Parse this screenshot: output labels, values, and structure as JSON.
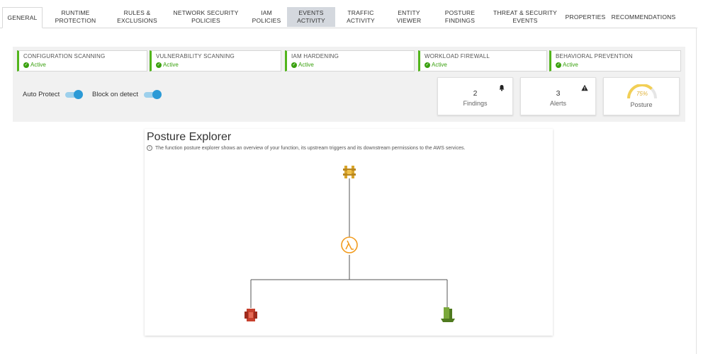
{
  "tabs": [
    {
      "label": "GENERAL"
    },
    {
      "label": "RUNTIME PROTECTION"
    },
    {
      "label": "RULES & EXCLUSIONS"
    },
    {
      "label": "NETWORK SECURITY POLICIES"
    },
    {
      "label": "IAM POLICIES"
    },
    {
      "label": "EVENTS ACTIVITY"
    },
    {
      "label": "TRAFFIC ACTIVITY"
    },
    {
      "label": "ENTITY VIEWER"
    },
    {
      "label": "POSTURE FINDINGS"
    },
    {
      "label": "THREAT & SECURITY EVENTS"
    },
    {
      "label": "PROPERTIES"
    },
    {
      "label": "RECOMMENDATIONS"
    }
  ],
  "modules": [
    {
      "title": "CONFIGURATION SCANNING",
      "status": "Active"
    },
    {
      "title": "VULNERABILITY SCANNING",
      "status": "Active"
    },
    {
      "title": "IAM HARDENING",
      "status": "Active"
    },
    {
      "title": "WORKLOAD FIREWALL",
      "status": "Active"
    },
    {
      "title": "BEHAVIORAL PREVENTION",
      "status": "Active"
    }
  ],
  "toggles": {
    "auto_protect": {
      "label": "Auto Protect",
      "on": true
    },
    "block_on_detect": {
      "label": "Block on detect",
      "on": true
    }
  },
  "cards": {
    "findings": {
      "value": "2",
      "label": "Findings",
      "icon": "bell-icon"
    },
    "alerts": {
      "value": "3",
      "label": "Alerts",
      "icon": "warning-icon"
    },
    "posture": {
      "value": "75%",
      "label": "Posture",
      "percent": 75
    }
  },
  "explorer": {
    "title": "Posture Explorer",
    "description": "The function posture explorer shows an overview of your function, its upstream triggers and its downstream permissions to the AWS services."
  },
  "colors": {
    "active_green": "#3aa10f",
    "toggle_blue": "#2b9ad6",
    "gauge_yellow": "#f2cf55",
    "lambda_orange": "#f29b1d",
    "trigger_gold": "#d8a52c",
    "service_red": "#c7402d",
    "service_green": "#6b9a2c"
  }
}
